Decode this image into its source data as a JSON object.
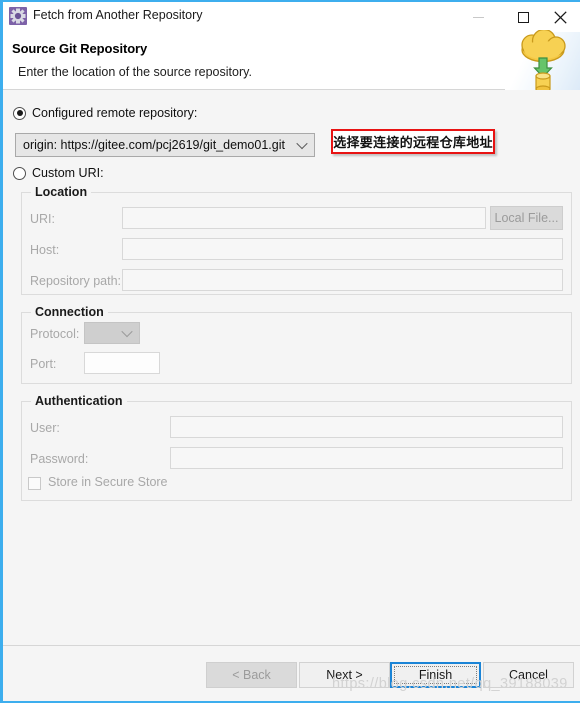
{
  "window": {
    "title": "Fetch from Another Repository",
    "icon": "eclipse-git-icon",
    "controls": {
      "minimize": "minimize-icon",
      "maximize": "maximize-icon",
      "close": "close-icon"
    }
  },
  "header": {
    "title": "Source Git Repository",
    "subtitle": "Enter the location of the source repository.",
    "artwork_icon": "cloud-download-to-database-icon"
  },
  "source": {
    "configured_radio": {
      "label": "Configured remote repository:",
      "selected": true
    },
    "custom_radio": {
      "label": "Custom URI:",
      "selected": false
    },
    "remote_combo": {
      "value": "origin: https://gitee.com/pcj2619/git_demo01.git",
      "options": [
        "origin: https://gitee.com/pcj2619/git_demo01.git"
      ]
    }
  },
  "annotation": {
    "text": "选择要连接的远程仓库地址",
    "border_color": "#e81313"
  },
  "location": {
    "legend": "Location",
    "uri_label": "URI:",
    "uri_value": "",
    "host_label": "Host:",
    "host_value": "",
    "repo_path_label": "Repository path:",
    "repo_path_value": "",
    "local_file_button": "Local File..."
  },
  "connection": {
    "legend": "Connection",
    "protocol_label": "Protocol:",
    "protocol_value": "",
    "port_label": "Port:",
    "port_value": ""
  },
  "authentication": {
    "legend": "Authentication",
    "user_label": "User:",
    "user_value": "",
    "password_label": "Password:",
    "password_value": "",
    "store_checkbox_label": "Store in Secure Store",
    "store_checked": false
  },
  "footer": {
    "back": "< Back",
    "next": "Next >",
    "finish": "Finish",
    "cancel": "Cancel"
  },
  "watermark": "https://blog.csdn.net/qq_39188039"
}
